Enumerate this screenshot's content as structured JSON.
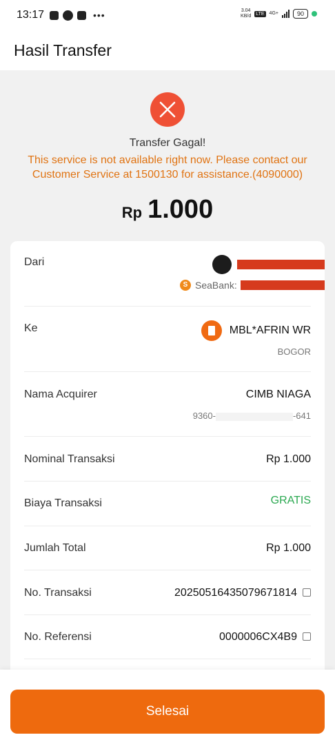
{
  "status_bar": {
    "time": "13:17",
    "speed_value": "3.04",
    "speed_unit": "KB/d",
    "network": "4G+",
    "lte": "LTE",
    "battery": "90"
  },
  "header": {
    "title": "Hasil Transfer"
  },
  "result": {
    "status_title": "Transfer Gagal!",
    "message": "This service is not available right now. Please contact our Customer Service at 1500130 for assistance.(4090000)",
    "amount_currency": "Rp",
    "amount_value": "1.000",
    "error_color": "#ef5035",
    "message_color": "#e07312"
  },
  "details": {
    "from_label": "Dari",
    "from_bank": "SeaBank:",
    "to_label": "Ke",
    "to_name": "MBL*AFRIN WR",
    "to_city": "BOGOR",
    "acquirer_label": "Nama Acquirer",
    "acquirer_name": "CIMB NIAGA",
    "acquirer_id_prefix": "9360-",
    "acquirer_id_suffix": "-641",
    "nominal_label": "Nominal Transaksi",
    "nominal_value": "Rp 1.000",
    "fee_label": "Biaya Transaksi",
    "fee_value": "GRATIS",
    "total_label": "Jumlah Total",
    "total_value": "Rp 1.000",
    "trx_no_label": "No. Transaksi",
    "trx_no_value": "20250516435079671814",
    "ref_no_label": "No. Referensi",
    "ref_no_value": "0000006CX4B9"
  },
  "footer": {
    "done_label": "Selesai",
    "accent": "#ee6a0e"
  }
}
